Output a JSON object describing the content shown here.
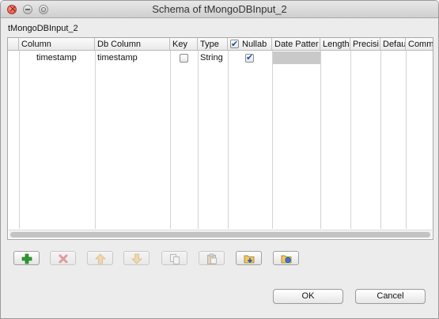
{
  "window": {
    "title": "Schema of tMongoDBInput_2"
  },
  "subtitle": "tMongoDBInput_2",
  "table": {
    "columns": [
      "Column",
      "Db Column",
      "Key",
      "Type",
      "Nullab",
      "Date Patter",
      "Length",
      "Precisi",
      "Defau",
      "Comm"
    ],
    "nullable_header_checked": true,
    "rows": [
      {
        "column": "timestamp",
        "db_column": "timestamp",
        "key": false,
        "type": "String",
        "nullable": true,
        "date_pattern": ""
      }
    ]
  },
  "toolbar": [
    {
      "name": "add-row-button",
      "icon": "plus-icon",
      "enabled": true
    },
    {
      "name": "remove-row-button",
      "icon": "x-icon",
      "enabled": false
    },
    {
      "name": "move-up-button",
      "icon": "arrow-up-icon",
      "enabled": false
    },
    {
      "name": "move-down-button",
      "icon": "arrow-down-icon",
      "enabled": false
    },
    {
      "name": "copy-button",
      "icon": "copy-icon",
      "enabled": false
    },
    {
      "name": "paste-button",
      "icon": "paste-icon",
      "enabled": false
    },
    {
      "name": "import-schema-button",
      "icon": "import-folder-icon",
      "enabled": true
    },
    {
      "name": "export-schema-button",
      "icon": "export-folder-icon",
      "enabled": true
    }
  ],
  "buttons": {
    "ok": "OK",
    "cancel": "Cancel"
  },
  "colors": {
    "accent_check": "#1a4fa8",
    "add_green": "#2f9e2f",
    "remove_red": "#d23a3a",
    "move_orange": "#e0a030"
  }
}
